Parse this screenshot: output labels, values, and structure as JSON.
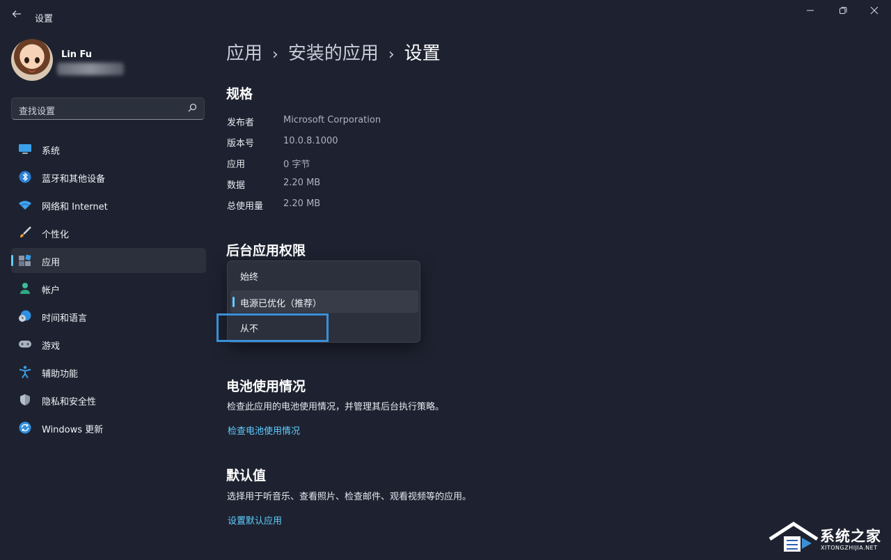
{
  "window": {
    "title": "设置",
    "back_icon": "arrow-left-icon",
    "minimize_icon": "minimize-icon",
    "restore_icon": "restore-icon",
    "close_icon": "close-icon"
  },
  "user": {
    "name": "Lin Fu"
  },
  "search": {
    "placeholder": "查找设置"
  },
  "sidebar": {
    "items": [
      {
        "label": "系统",
        "icon": "monitor-icon"
      },
      {
        "label": "蓝牙和其他设备",
        "icon": "bluetooth-icon"
      },
      {
        "label": "网络和 Internet",
        "icon": "wifi-icon"
      },
      {
        "label": "个性化",
        "icon": "paintbrush-icon"
      },
      {
        "label": "应用",
        "icon": "apps-icon",
        "active": true
      },
      {
        "label": "帐户",
        "icon": "person-icon"
      },
      {
        "label": "时间和语言",
        "icon": "globe-clock-icon"
      },
      {
        "label": "游戏",
        "icon": "gamepad-icon"
      },
      {
        "label": "辅助功能",
        "icon": "accessibility-icon"
      },
      {
        "label": "隐私和安全性",
        "icon": "shield-icon"
      },
      {
        "label": "Windows 更新",
        "icon": "update-icon"
      }
    ]
  },
  "breadcrumb": [
    "应用",
    "安装的应用",
    "设置"
  ],
  "specs": {
    "title": "规格",
    "rows": [
      {
        "label": "发布者",
        "value": "Microsoft Corporation"
      },
      {
        "label": "版本号",
        "value": "10.0.8.1000"
      },
      {
        "label": "应用",
        "value": "0 字节"
      },
      {
        "label": "数据",
        "value": "2.20 MB"
      },
      {
        "label": "总使用量",
        "value": "2.20 MB"
      }
    ]
  },
  "background": {
    "title": "后台应用权限",
    "options": [
      "始终",
      "电源已优化（推荐）",
      "从不"
    ],
    "selected": "电源已优化（推荐）"
  },
  "battery": {
    "title": "电池使用情况",
    "description": "检查此应用的电池使用情况，并管理其后台执行策略。",
    "link": "检查电池使用情况"
  },
  "defaults": {
    "title": "默认值",
    "description": "选择用于听音乐、查看照片、检查邮件、观看视频等的应用。",
    "link": "设置默认应用"
  },
  "watermark": {
    "cn": "系统之家",
    "en": "XITONGZHIJIA.NET"
  },
  "colors": {
    "accent": "#60cdff",
    "background": "#1e2230",
    "highlight_box": "#3a8fd8"
  }
}
